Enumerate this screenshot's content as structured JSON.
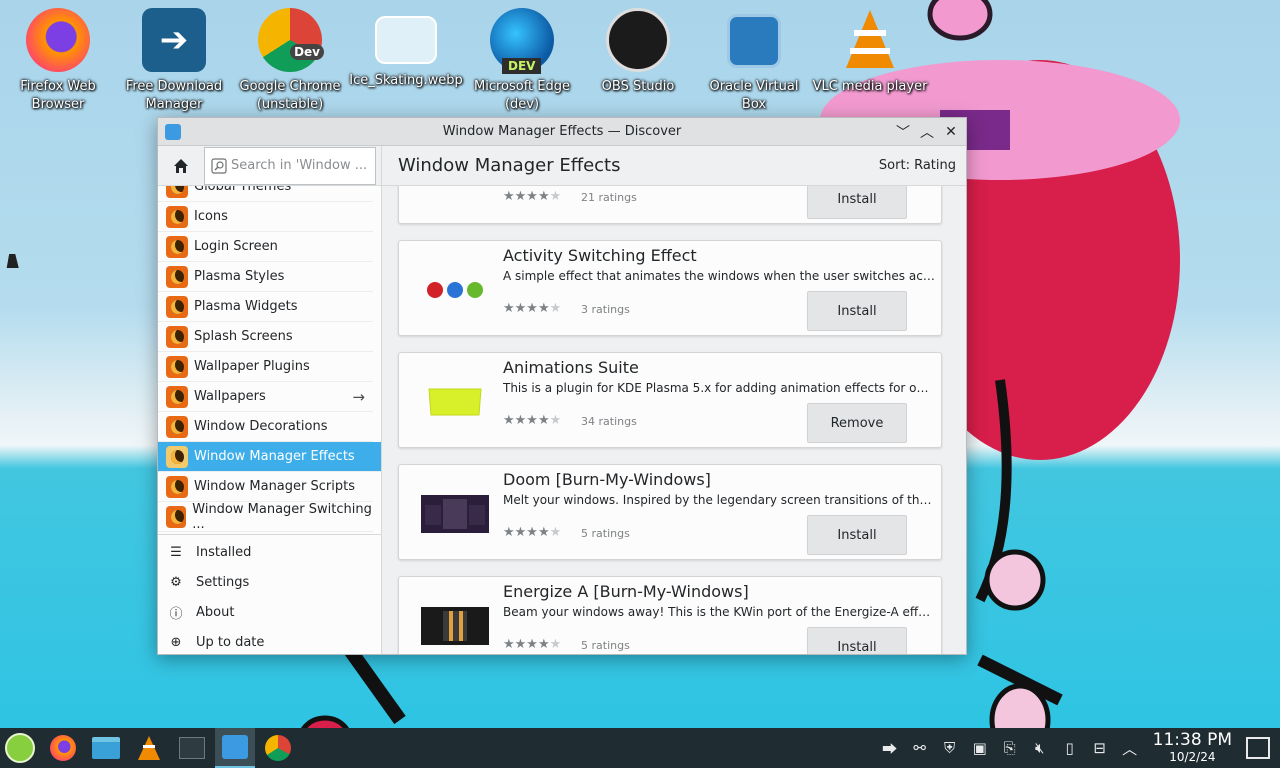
{
  "desktop": {
    "icons": [
      {
        "label": "Firefox Web Browser",
        "icon": "firefox-icon"
      },
      {
        "label": "Free Download Manager",
        "icon": "fdm-icon"
      },
      {
        "label": "Google Chrome (unstable)",
        "icon": "chrome-dev-icon",
        "badge": "Dev"
      },
      {
        "label": "Ice_Skating.webp",
        "icon": "image-file-icon"
      },
      {
        "label": "Microsoft Edge (dev)",
        "icon": "edge-dev-icon",
        "badge": "DEV"
      },
      {
        "label": "OBS Studio",
        "icon": "obs-icon"
      },
      {
        "label": "Oracle Virtual Box",
        "icon": "virtualbox-icon"
      },
      {
        "label": "VLC media player",
        "icon": "vlc-icon"
      }
    ]
  },
  "window": {
    "title": "Window Manager Effects — Discover",
    "search_placeholder": "Search in 'Window ...",
    "page_title": "Window Manager Effects",
    "sort_label": "Sort: Rating"
  },
  "sidebar": {
    "categories": [
      {
        "label": "Global Themes"
      },
      {
        "label": "Icons"
      },
      {
        "label": "Login Screen"
      },
      {
        "label": "Plasma Styles"
      },
      {
        "label": "Plasma Widgets"
      },
      {
        "label": "Splash Screens"
      },
      {
        "label": "Wallpaper Plugins"
      },
      {
        "label": "Wallpapers"
      },
      {
        "label": "Window Decorations"
      },
      {
        "label": "Window Manager Effects"
      },
      {
        "label": "Window Manager Scripts"
      },
      {
        "label": "Window Manager Switching ..."
      }
    ],
    "active_index": 9,
    "nav": [
      {
        "label": "Installed",
        "icon": "list-icon"
      },
      {
        "label": "Settings",
        "icon": "gear-icon"
      },
      {
        "label": "About",
        "icon": "info-icon"
      },
      {
        "label": "Up to date",
        "icon": "update-icon"
      }
    ]
  },
  "apps": [
    {
      "name": "",
      "desc": "",
      "rating": 4,
      "ratings": "21 ratings",
      "action": "Install"
    },
    {
      "name": "Activity Switching Effect",
      "desc": "A simple effect that animates the windows when the user switches acti...",
      "rating": 4,
      "ratings": "3 ratings",
      "action": "Install"
    },
    {
      "name": "Animations Suite",
      "desc": "This is a plugin for KDE Plasma 5.x for adding animation effects for ope...",
      "rating": 4,
      "ratings": "34 ratings",
      "action": "Remove"
    },
    {
      "name": "Doom [Burn-My-Windows]",
      "desc": "Melt your windows. Inspired by the legendary screen transitions of the ...",
      "rating": 4,
      "ratings": "5 ratings",
      "action": "Install"
    },
    {
      "name": "Energize A [Burn-My-Windows]",
      "desc": "Beam your windows away! This is the KWin port of the Energize-A effec...",
      "rating": 4,
      "ratings": "5 ratings",
      "action": "Install"
    }
  ],
  "taskbar": {
    "time": "11:38 PM",
    "date": "10/2/24"
  },
  "colors": {
    "accent": "#3daee9",
    "taskbar": "#1f2d32"
  }
}
